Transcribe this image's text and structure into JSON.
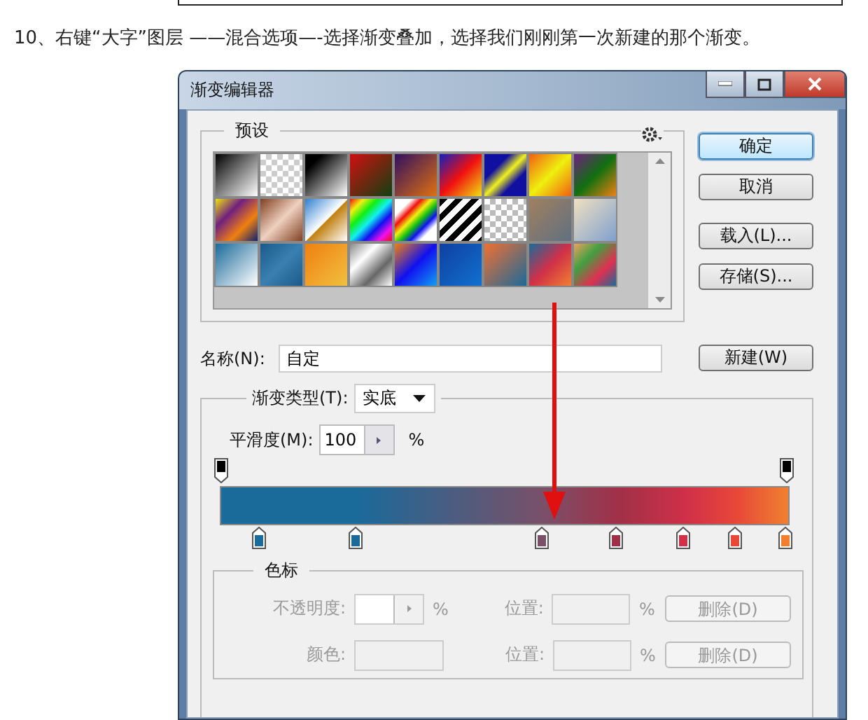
{
  "instruction": "10、右键“大字”图层 ——混合选项—-选择渐变叠加，选择我们刚刚第一次新建的那个渐变。",
  "dialog": {
    "title": "渐变编辑器",
    "presets": {
      "label": "预设"
    },
    "buttons": [
      {
        "label": "确定",
        "default": true
      },
      {
        "label": "取消",
        "default": false
      },
      {
        "label": "载入(L)...",
        "default": false
      },
      {
        "label": "存储(S)...",
        "default": false
      }
    ],
    "name_field": {
      "label": "名称(N):",
      "value": "自定"
    },
    "new_button": "新建(W)",
    "gradient_type": {
      "label": "渐变类型(T):",
      "value": "实底"
    },
    "smoothness": {
      "label": "平滑度(M):",
      "value": "100",
      "unit": "%"
    },
    "opacity_stops": [
      {
        "color": "#000000"
      },
      {
        "color": "#000000"
      }
    ],
    "color_stops": [
      {
        "color": "#1a6a9a"
      },
      {
        "color": "#1a6a9a"
      },
      {
        "color": "#7a5068"
      },
      {
        "color": "#a03048"
      },
      {
        "color": "#d03048"
      },
      {
        "color": "#e84838"
      },
      {
        "color": "#f08030"
      }
    ],
    "stops_group": {
      "title": "色标",
      "disabled": true,
      "rows": [
        {
          "kind": "stepper",
          "label": "不透明度:",
          "unit": "%",
          "position_label": "位置:",
          "position_unit": "%",
          "delete_button": "删除(D)"
        },
        {
          "kind": "swatch",
          "label": "颜色:",
          "position_label": "位置:",
          "position_unit": "%",
          "delete_button": "删除(D)"
        }
      ]
    }
  }
}
